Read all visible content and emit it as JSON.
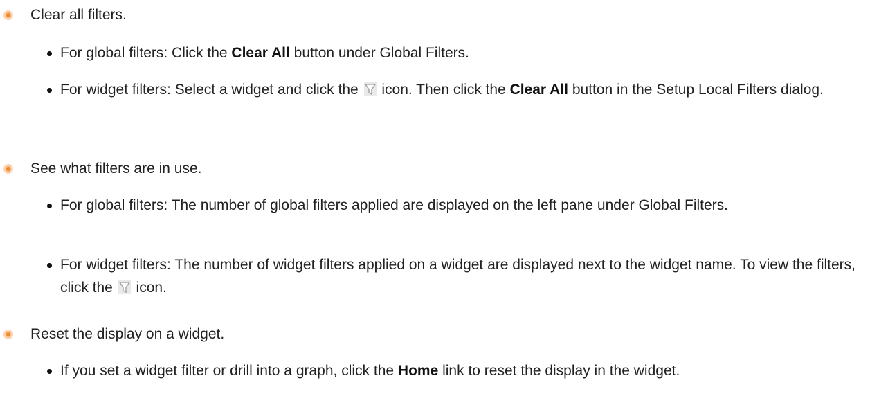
{
  "items": [
    {
      "text": "Clear all filters.",
      "subs": [
        {
          "before": "For global filters: Click the ",
          "bold": "Clear All",
          "after": " button under Global Filters."
        },
        {
          "before": "For widget filters: Select a widget and click the ",
          "icon": "filter-icon",
          "mid": " icon. Then click the ",
          "bold": "Clear All",
          "after": " button in the Setup Local Filters dialog."
        }
      ]
    },
    {
      "text": "See what filters are in use.",
      "subs": [
        {
          "before": "For global filters: The number of global filters applied are displayed on the left pane under Global Filters."
        },
        {
          "before": "For widget filters: The number of widget filters applied on a widget are displayed next to the widget name. To view the filters, click the ",
          "icon": "filter-icon",
          "after": " icon."
        }
      ]
    },
    {
      "text": "Reset the display on a widget.",
      "subs": [
        {
          "before": "If you set a widget filter or drill into a graph, click the ",
          "bold": "Home",
          "after": " link to reset the display in the widget."
        }
      ]
    }
  ],
  "colors": {
    "bullet": "#f08a30",
    "text": "#222222",
    "icon": "#b0b0b0"
  }
}
